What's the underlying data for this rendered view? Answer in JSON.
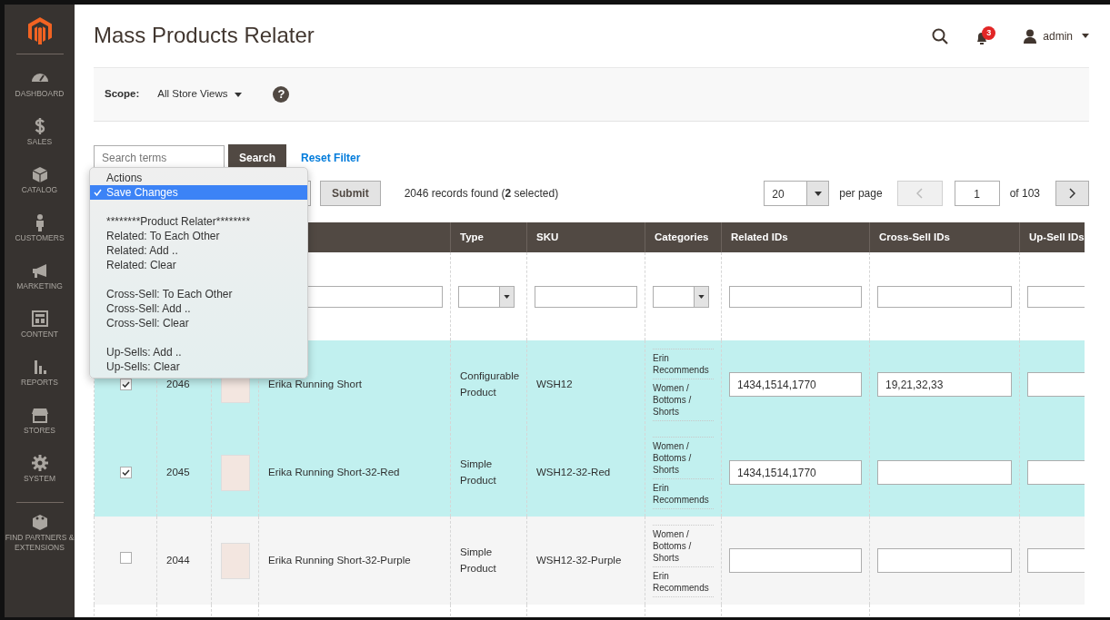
{
  "sidebar": {
    "items": [
      {
        "label": "DASHBOARD"
      },
      {
        "label": "SALES"
      },
      {
        "label": "CATALOG"
      },
      {
        "label": "CUSTOMERS"
      },
      {
        "label": "MARKETING"
      },
      {
        "label": "CONTENT"
      },
      {
        "label": "REPORTS"
      },
      {
        "label": "STORES"
      },
      {
        "label": "SYSTEM"
      },
      {
        "label": "FIND PARTNERS & EXTENSIONS"
      }
    ]
  },
  "header": {
    "title": "Mass Products Relater",
    "notification_count": "3",
    "user": "admin"
  },
  "scope": {
    "label": "Scope:",
    "value": "All Store Views",
    "help": "?"
  },
  "search": {
    "placeholder": "Search terms",
    "button": "Search",
    "reset": "Reset Filter"
  },
  "toolbar": {
    "submit": "Submit",
    "records": "2046 records found (**2** selected)",
    "page_size": "20",
    "per_page": "per page",
    "page": "1",
    "page_total": "of 103"
  },
  "action_menu": {
    "groups": [
      [
        {
          "label": "Actions",
          "selected": false
        },
        {
          "label": "Save Changes",
          "selected": true
        }
      ],
      [
        {
          "label": "********Product Relater********",
          "selected": false
        },
        {
          "label": "Related: To Each Other",
          "selected": false
        },
        {
          "label": "Related: Add ..",
          "selected": false
        },
        {
          "label": "Related: Clear",
          "selected": false
        }
      ],
      [
        {
          "label": "Cross-Sell: To Each Other",
          "selected": false
        },
        {
          "label": "Cross-Sell: Add ..",
          "selected": false
        },
        {
          "label": "Cross-Sell: Clear",
          "selected": false
        }
      ],
      [
        {
          "label": "Up-Sells: Add ..",
          "selected": false
        },
        {
          "label": "Up-Sells: Clear",
          "selected": false
        }
      ]
    ]
  },
  "table": {
    "columns": [
      "Type",
      "SKU",
      "Categories",
      "Related IDs",
      "Cross-Sell IDs",
      "Up-Sell IDs"
    ],
    "rows": [
      {
        "checked": true,
        "id": "2046",
        "name": "Erika Running Short",
        "type": "Configurable Product",
        "sku": "WSH12",
        "categories": [
          "Erin Recommends",
          "Women / Bottoms / Shorts"
        ],
        "related_ids": "1434,1514,1770",
        "cross_sell_ids": "19,21,32,33"
      },
      {
        "checked": true,
        "id": "2045",
        "name": "Erika Running Short-32-Red",
        "type": "Simple Product",
        "sku": "WSH12-32-Red",
        "categories": [
          "Women / Bottoms / Shorts",
          "Erin Recommends"
        ],
        "related_ids": "1434,1514,1770"
      },
      {
        "checked": false,
        "id": "2044",
        "name": "Erika Running Short-32-Purple",
        "type": "Simple Product",
        "sku": "WSH12-32-Purple",
        "categories": [
          "Women / Bottoms / Shorts",
          "Erin Recommends"
        ]
      }
    ]
  }
}
